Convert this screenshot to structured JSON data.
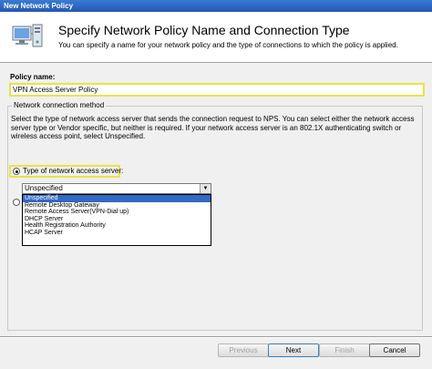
{
  "window": {
    "title": "New Network Policy"
  },
  "header": {
    "title": "Specify Network Policy Name and Connection Type",
    "subtitle": "You can specify a name for your network policy and the type of connections to which the policy is applied."
  },
  "policy": {
    "label": "Policy name:",
    "value": "VPN Access Server Policy"
  },
  "connection": {
    "group_title": "Network connection method",
    "description": "Select the type of network access server that sends the connection request to NPS. You can select either the network access server type or Vendor specific, but neither is required.  If your network access server is an 802.1X authenticating switch or wireless access point, select Unspecified.",
    "radio_type_label": "Type of network access server:",
    "selected_type": "Unspecified",
    "options": [
      "Unspecified",
      "Remote Desktop Gateway",
      "Remote Access Server(VPN-Dial up)",
      "DHCP Server",
      "Health Registration Authority",
      "HCAP Server"
    ]
  },
  "buttons": {
    "previous": "Previous",
    "next": "Next",
    "finish": "Finish",
    "cancel": "Cancel"
  },
  "colors": {
    "titlebar": "#2358b4",
    "highlight": "#e7e347",
    "selection": "#3169c6"
  }
}
